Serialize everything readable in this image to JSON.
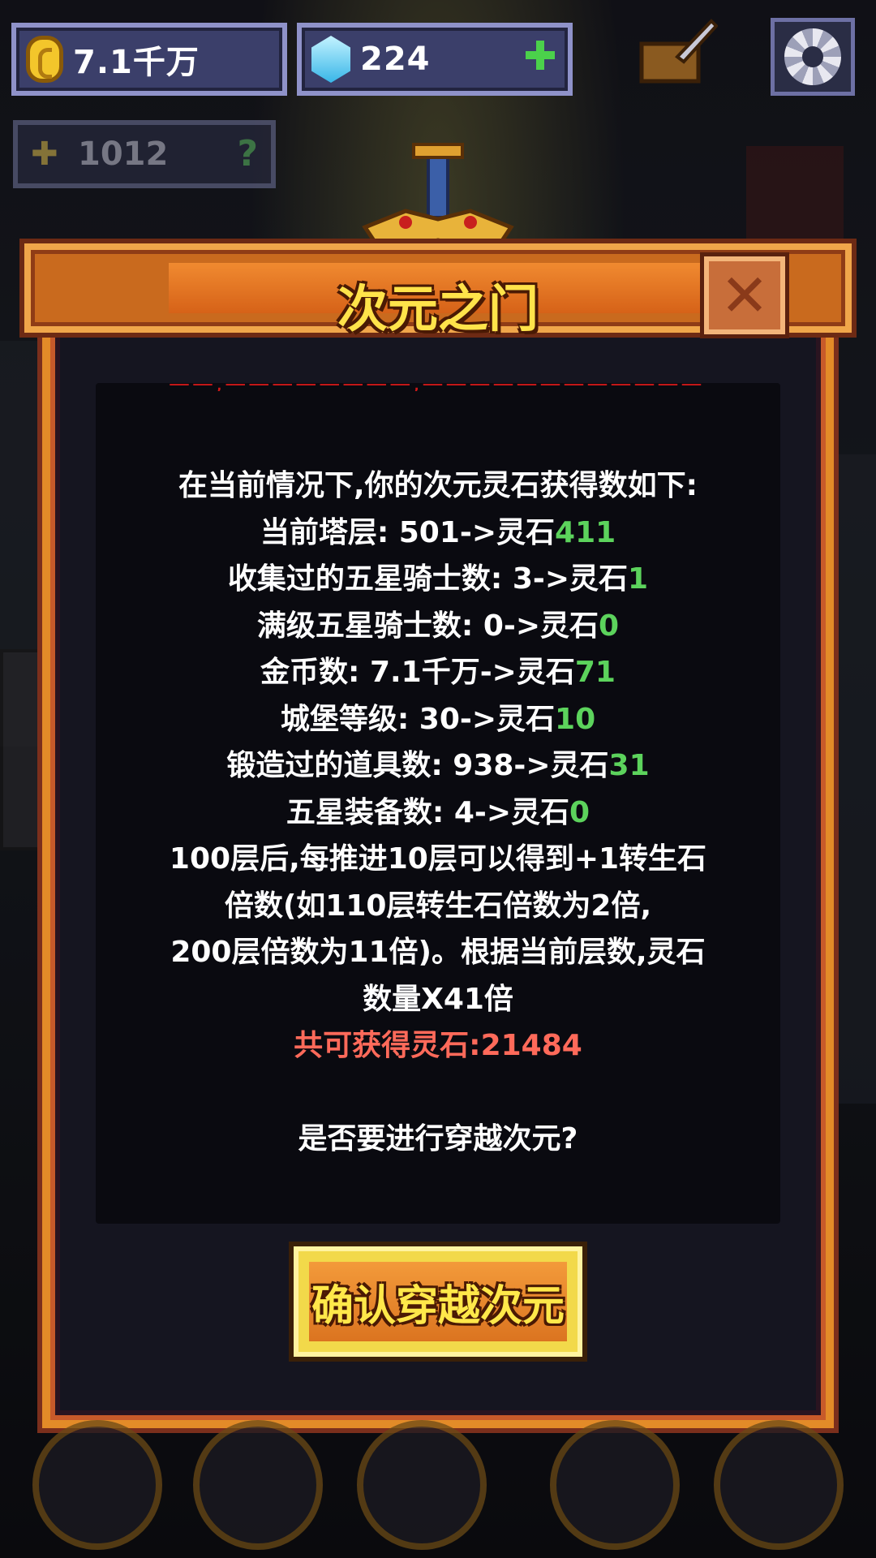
{
  "hud": {
    "gold": "7.1千万",
    "gems": "224",
    "power": "1012",
    "icons": [
      "coin-icon",
      "gem-icon",
      "plus-icon",
      "quill-icon",
      "gear-icon",
      "power-icon",
      "help-icon"
    ]
  },
  "dialog": {
    "title": "次元之门",
    "truncated_line": "——,————————,——————————————,",
    "lines": [
      {
        "parts": [
          {
            "t": "在当前情况下,你的次元灵石获得数如下:",
            "c": ""
          }
        ]
      },
      {
        "parts": [
          {
            "t": "当前塔层: 501->灵石",
            "c": ""
          },
          {
            "t": "411",
            "c": "green"
          }
        ]
      },
      {
        "parts": [
          {
            "t": "收集过的五星骑士数: 3->灵石",
            "c": ""
          },
          {
            "t": "1",
            "c": "green"
          }
        ]
      },
      {
        "parts": [
          {
            "t": "满级五星骑士数: 0->灵石",
            "c": ""
          },
          {
            "t": "0",
            "c": "green"
          }
        ]
      },
      {
        "parts": [
          {
            "t": "金币数: 7.1千万->灵石",
            "c": ""
          },
          {
            "t": "71",
            "c": "green"
          }
        ]
      },
      {
        "parts": [
          {
            "t": "城堡等级: 30->灵石",
            "c": ""
          },
          {
            "t": "10",
            "c": "green"
          }
        ]
      },
      {
        "parts": [
          {
            "t": "锻造过的道具数: 938->灵石",
            "c": ""
          },
          {
            "t": "31",
            "c": "green"
          }
        ]
      },
      {
        "parts": [
          {
            "t": "五星装备数: 4->灵石",
            "c": ""
          },
          {
            "t": "0",
            "c": "green"
          }
        ]
      },
      {
        "parts": [
          {
            "t": "100层后,每推进10层可以得到+1转生石",
            "c": ""
          }
        ]
      },
      {
        "parts": [
          {
            "t": "倍数(如110层转生石倍数为2倍,",
            "c": ""
          }
        ]
      },
      {
        "parts": [
          {
            "t": "200层倍数为11倍)。根据当前层数,灵石",
            "c": ""
          }
        ]
      },
      {
        "parts": [
          {
            "t": "数量X41倍",
            "c": ""
          }
        ]
      },
      {
        "parts": [
          {
            "t": "共可获得灵石:21484",
            "c": "red"
          }
        ]
      },
      {
        "parts": [
          {
            "t": "",
            "c": ""
          }
        ]
      },
      {
        "parts": [
          {
            "t": "是否要进行穿越次元?",
            "c": ""
          }
        ]
      }
    ],
    "confirm_label": "确认穿越次元"
  },
  "colors": {
    "accent_green": "#5cd35c",
    "accent_red": "#ff6a5a",
    "title_yellow": "#ffe34a",
    "frame_orange": "#e38b28"
  }
}
